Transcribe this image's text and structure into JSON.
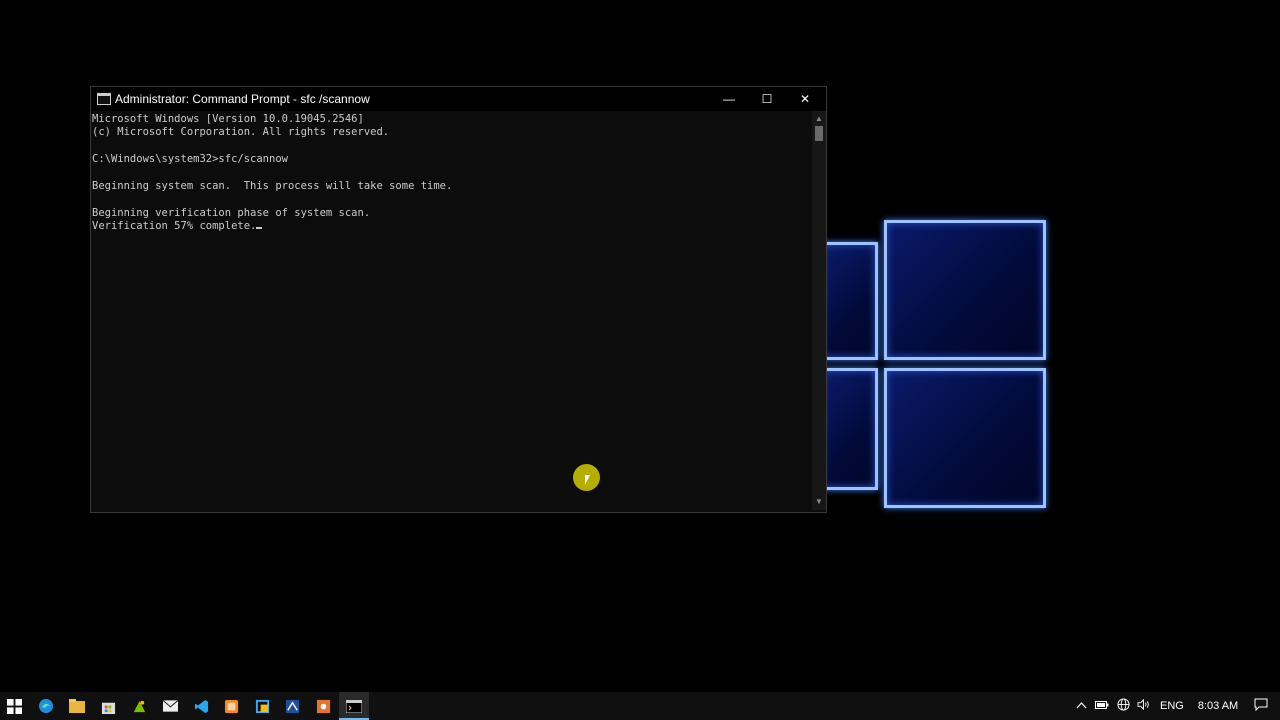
{
  "window": {
    "title": "Administrator: Command Prompt - sfc /scannow",
    "minimize_glyph": "—",
    "maximize_glyph": "☐",
    "close_glyph": "✕"
  },
  "console": {
    "lines": [
      "Microsoft Windows [Version 10.0.19045.2546]",
      "(c) Microsoft Corporation. All rights reserved.",
      "",
      "C:\\Windows\\system32>sfc/scannow",
      "",
      "Beginning system scan.  This process will take some time.",
      "",
      "Beginning verification phase of system scan.",
      "Verification 57% complete."
    ]
  },
  "taskbar": {
    "icons": [
      "windows-start-icon",
      "edge-icon",
      "file-explorer-icon",
      "store-icon",
      "photos-icon",
      "mail-icon",
      "vscode-icon",
      "app-orange-icon",
      "snipping-icon",
      "app-blue-icon",
      "app-orange2-icon",
      "command-prompt-icon"
    ],
    "tray": {
      "language": "ENG",
      "time": "8:03 AM"
    }
  },
  "colors": {
    "console_bg": "#0c0c0c",
    "console_text": "#cccccc",
    "accent": "#76b9ed",
    "cursor_highlight": "#c8c000"
  }
}
